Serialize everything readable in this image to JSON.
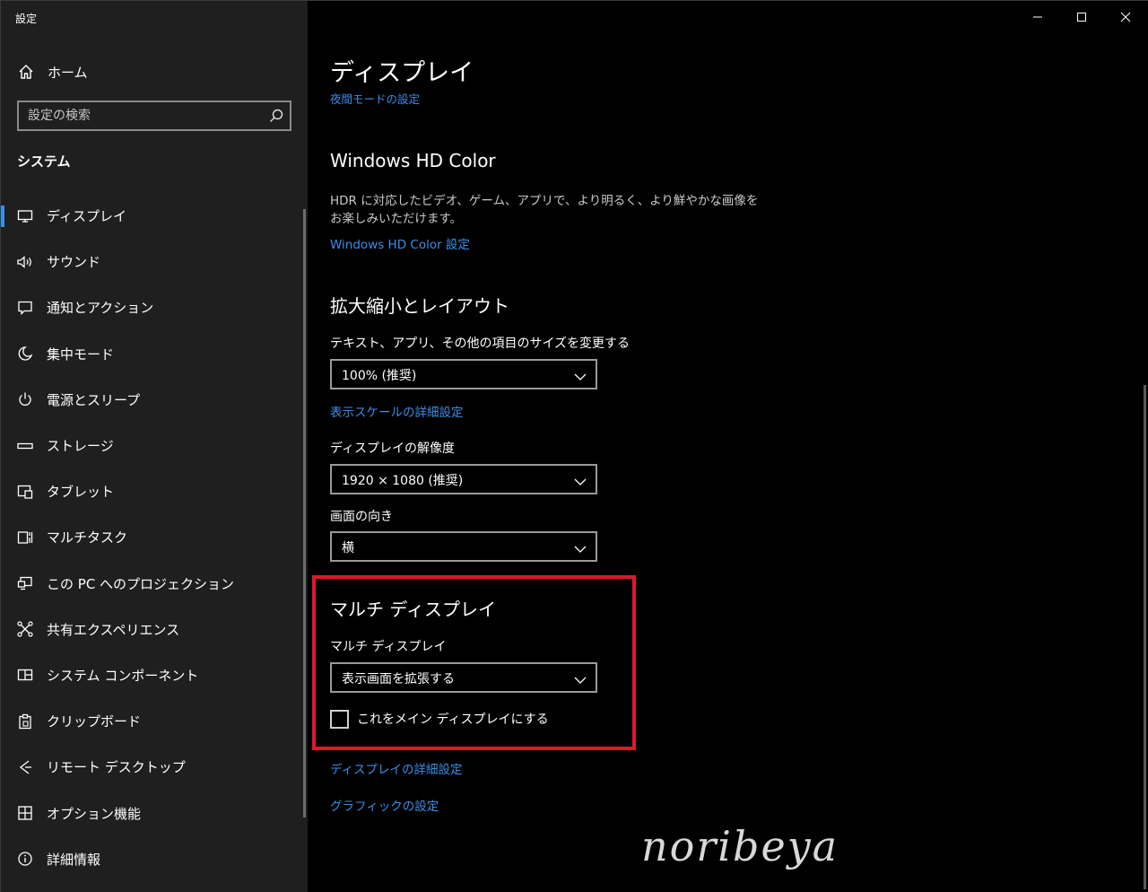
{
  "window": {
    "title": "設定",
    "minimize_icon": "minimize-icon",
    "maximize_icon": "maximize-icon",
    "close_icon": "close-icon"
  },
  "sidebar": {
    "home_label": "ホーム",
    "search_placeholder": "設定の検索",
    "section_label": "システム",
    "items": [
      {
        "label": "ディスプレイ",
        "icon": "monitor-icon",
        "active": true
      },
      {
        "label": "サウンド",
        "icon": "speaker-icon"
      },
      {
        "label": "通知とアクション",
        "icon": "notification-icon"
      },
      {
        "label": "集中モード",
        "icon": "moon-icon"
      },
      {
        "label": "電源とスリープ",
        "icon": "power-icon"
      },
      {
        "label": "ストレージ",
        "icon": "storage-icon"
      },
      {
        "label": "タブレット",
        "icon": "tablet-icon"
      },
      {
        "label": "マルチタスク",
        "icon": "multitask-icon"
      },
      {
        "label": "この PC へのプロジェクション",
        "icon": "projection-icon"
      },
      {
        "label": "共有エクスペリエンス",
        "icon": "shared-experience-icon"
      },
      {
        "label": "システム コンポーネント",
        "icon": "components-icon"
      },
      {
        "label": "クリップボード",
        "icon": "clipboard-icon"
      },
      {
        "label": "リモート デスクトップ",
        "icon": "remote-desktop-icon"
      },
      {
        "label": "オプション機能",
        "icon": "optional-features-icon"
      },
      {
        "label": "詳細情報",
        "icon": "info-icon"
      }
    ]
  },
  "main": {
    "title": "ディスプレイ",
    "night_light_link": "夜間モードの設定",
    "hdr": {
      "heading": "Windows HD Color",
      "description": "HDR に対応したビデオ、ゲーム、アプリで、より明るく、より鮮やかな画像をお楽しみいただけます。",
      "link": "Windows HD Color 設定"
    },
    "scale": {
      "heading": "拡大縮小とレイアウト",
      "size_label": "テキスト、アプリ、その他の項目のサイズを変更する",
      "size_value": "100% (推奨)",
      "advanced_link": "表示スケールの詳細設定",
      "resolution_label": "ディスプレイの解像度",
      "resolution_value": "1920 × 1080 (推奨)",
      "orientation_label": "画面の向き",
      "orientation_value": "横"
    },
    "multi": {
      "heading": "マルチ ディスプレイ",
      "label": "マルチ ディスプレイ",
      "value": "表示画面を拡張する",
      "main_display_checkbox": "これをメイン ディスプレイにする",
      "main_display_checked": false
    },
    "advanced_display_link": "ディスプレイの詳細設定",
    "graphics_link": "グラフィックの設定"
  },
  "watermark": "noribeya"
}
